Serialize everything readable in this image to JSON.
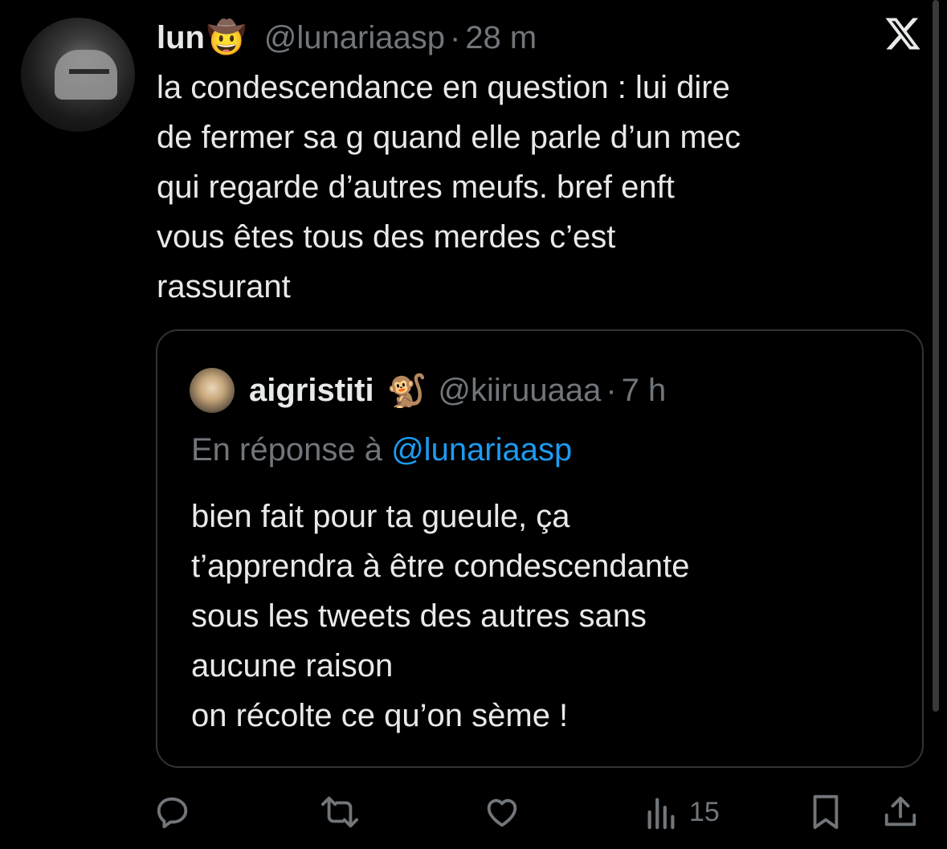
{
  "tweet": {
    "author_name": "lun",
    "author_emoji": "🤠",
    "handle": "@lunariaasp",
    "separator": "·",
    "time": "28 m",
    "text_lines": [
      "la condescendance en question : lui dire",
      "de fermer sa g quand elle parle d’un mec",
      "qui regarde d’autres meufs. bref enft",
      "vous êtes tous des merdes c’est",
      "rassurant"
    ]
  },
  "quoted": {
    "author_name": "aigristiti",
    "author_emoji": "🐒",
    "handle": "@kiiruuaaa",
    "separator": "·",
    "time": "7 h",
    "reply_prefix": "En réponse à",
    "reply_mention": "@lunariaasp",
    "text_lines": [
      "bien fait pour ta gueule, ça",
      "t’apprendra à être condescendante",
      "sous les tweets des autres sans",
      "aucune raison",
      "on récolte ce qu’on sème !"
    ]
  },
  "actions": {
    "views_count": "15"
  },
  "icons": [
    "x-logo-icon",
    "reply-icon",
    "retweet-icon",
    "like-icon",
    "views-icon",
    "bookmark-icon",
    "share-icon"
  ],
  "colors": {
    "background": "#000000",
    "text": "#e7e9ea",
    "muted": "#71767b",
    "accent": "#1d9bf0",
    "border": "#2f3336"
  }
}
